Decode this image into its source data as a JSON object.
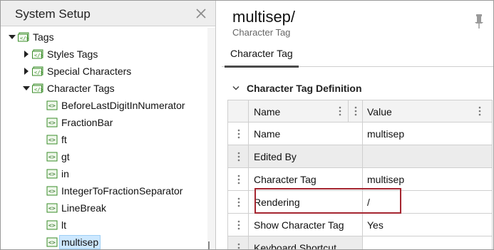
{
  "left_panel": {
    "title": "System Setup",
    "tree": {
      "root": "Tags",
      "items": [
        {
          "label": "Styles Tags",
          "expanded": false
        },
        {
          "label": "Special Characters",
          "expanded": false
        },
        {
          "label": "Character Tags",
          "expanded": true
        }
      ],
      "character_tags": [
        "BeforeLastDigitInNumerator",
        "FractionBar",
        "ft",
        "gt",
        "in",
        "IntegerToFractionSeparator",
        "LineBreak",
        "lt",
        "multisep"
      ],
      "selected": "multisep"
    }
  },
  "right_panel": {
    "title": "multisep/",
    "subtitle": "Character Tag",
    "tab": "Character Tag",
    "section": "Character Tag Definition",
    "columns": [
      "Name",
      "Value"
    ],
    "rows": [
      {
        "name": "Name",
        "value": "multisep"
      },
      {
        "name": "Edited By",
        "value": ""
      },
      {
        "name": "Character Tag",
        "value": "multisep"
      },
      {
        "name": "Rendering",
        "value": "/"
      },
      {
        "name": "Show Character Tag",
        "value": "Yes"
      },
      {
        "name": "Keyboard Shortcut",
        "value": ""
      }
    ]
  },
  "colors": {
    "highlight_border": "#a52630",
    "selection": "#cde8ff",
    "icon_green": "#3a8c2a"
  }
}
